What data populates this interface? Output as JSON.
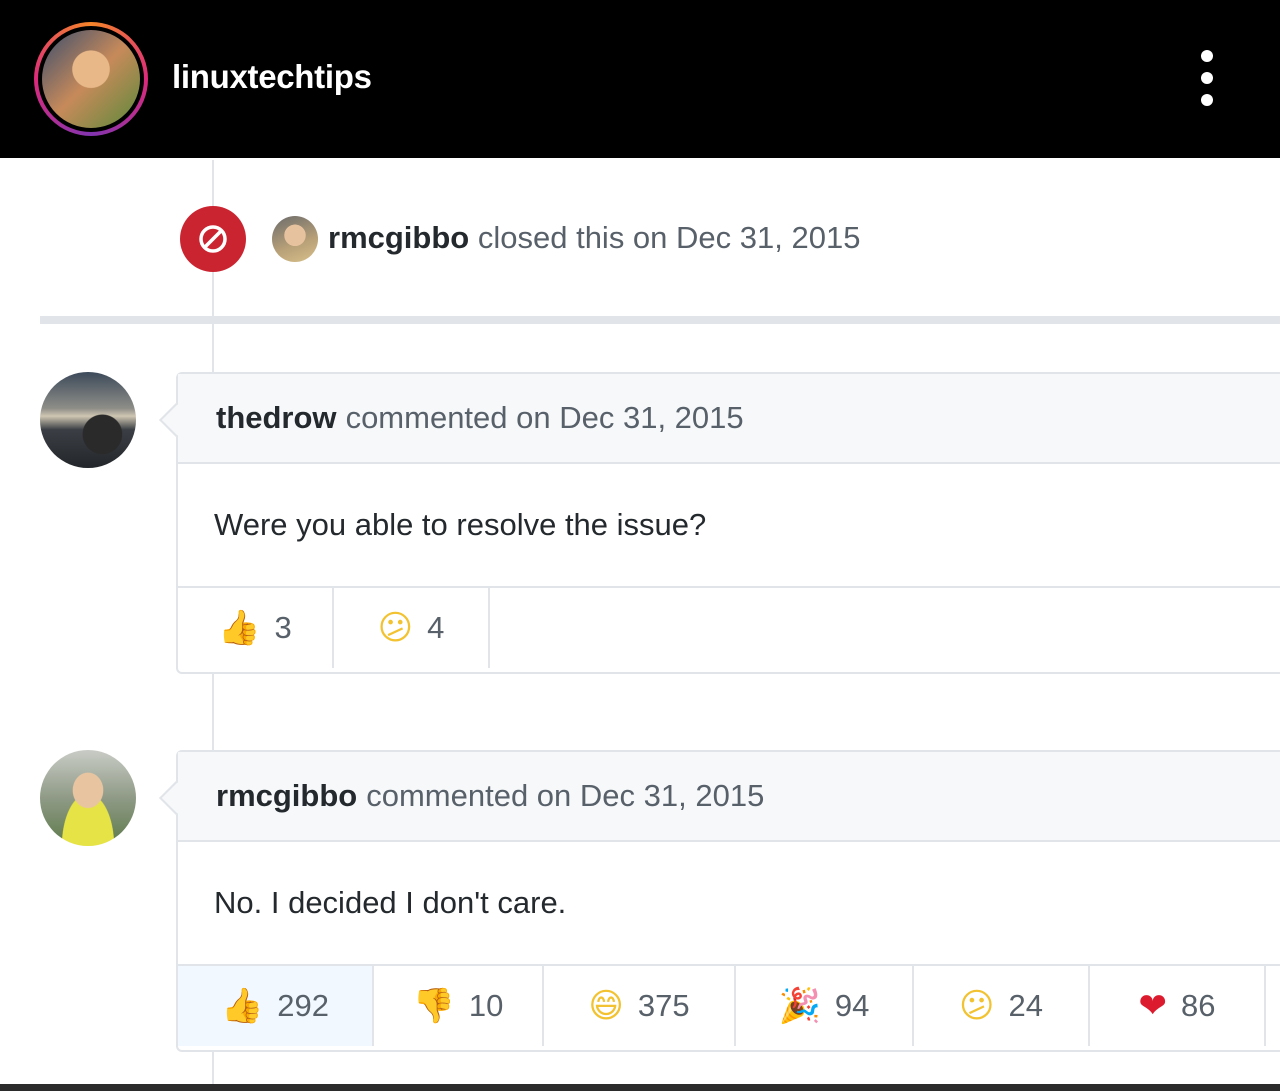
{
  "header": {
    "username": "linuxtechtips",
    "more_icon": "more-vertical-icon"
  },
  "closed_event": {
    "user": "rmcgibbo",
    "text": "closed this on Dec 31, 2015",
    "badge_icon": "circle-slash-icon",
    "badge_color": "#cb2431"
  },
  "comments": [
    {
      "author": "thedrow",
      "meta": "commented on Dec 31, 2015",
      "body": "Were you able to resolve the issue?",
      "reactions": [
        {
          "icon": "thumbs-up-icon",
          "glyph": "👍",
          "count": "3"
        },
        {
          "icon": "confused-face-icon",
          "glyph": "😕",
          "count": "4"
        }
      ]
    },
    {
      "author": "rmcgibbo",
      "meta": "commented on Dec 31, 2015",
      "body": "No. I decided I don't care.",
      "reactions": [
        {
          "icon": "thumbs-up-icon",
          "glyph": "👍",
          "count": "292"
        },
        {
          "icon": "thumbs-down-icon",
          "glyph": "👎",
          "count": "10"
        },
        {
          "icon": "laugh-face-icon",
          "glyph": "😄",
          "count": "375"
        },
        {
          "icon": "tada-icon",
          "glyph": "🎉",
          "count": "94"
        },
        {
          "icon": "confused-face-icon",
          "glyph": "😕",
          "count": "24"
        },
        {
          "icon": "heart-icon",
          "glyph": "❤",
          "count": "86"
        }
      ]
    }
  ],
  "colors": {
    "header_bg": "#000000",
    "border": "#e1e4e8",
    "head_bg": "#f6f8fa",
    "muted_text": "#586069",
    "active_reaction_bg": "#f1f8ff"
  }
}
